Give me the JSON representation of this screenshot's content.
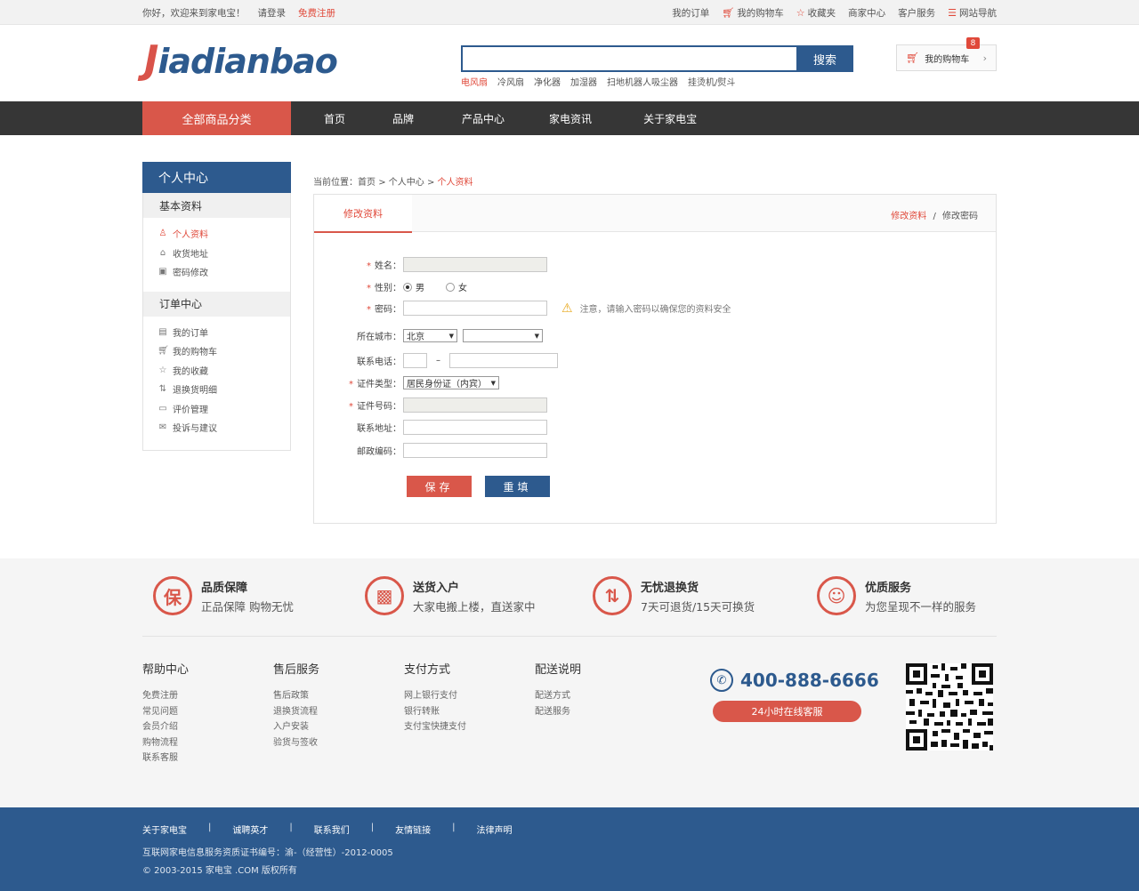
{
  "topbar": {
    "welcome": "你好，欢迎来到家电宝！",
    "login": "请登录",
    "register": "免费注册",
    "links": [
      "我的订单",
      "我的购物车",
      "收藏夹",
      "商家中心",
      "客户服务",
      "网站导航"
    ]
  },
  "header": {
    "logo_first": "J",
    "logo_rest": "iadianbao",
    "search_button": "搜索",
    "search_value": "",
    "hot_words": [
      "电风扇",
      "冷风扇",
      "净化器",
      "加湿器",
      "扫地机器人吸尘器",
      "挂烫机/熨斗"
    ],
    "cart_label": "我的购物车",
    "cart_count": "8"
  },
  "nav": {
    "all_categories": "全部商品分类",
    "items": [
      "首页",
      "品牌",
      "产品中心",
      "家电资讯",
      "关于家电宝"
    ]
  },
  "sidebar": {
    "title": "个人中心",
    "sections": [
      {
        "label": "基本资料",
        "items": [
          "个人资料",
          "收货地址",
          "密码修改"
        ]
      },
      {
        "label": "订单中心",
        "items": [
          "我的订单",
          "我的购物车",
          "我的收藏",
          "退换货明细",
          "评价管理",
          "投诉与建议"
        ]
      }
    ]
  },
  "breadcrumb": {
    "prefix": "当前位置：",
    "home": "首页",
    "sep": ">",
    "level2": "个人中心",
    "current": "个人资料"
  },
  "panel": {
    "tab": "修改资料",
    "link_active": "修改资料",
    "link_sep": "/",
    "link_other": "修改密码"
  },
  "form": {
    "name_label": "姓名：",
    "gender_label": "性别：",
    "gender_male": "男",
    "gender_female": "女",
    "password_label": "密码：",
    "password_warning": "注意，请输入密码以确保您的资料安全",
    "city_label": "所在城市：",
    "city_value": "北京",
    "district_value": "",
    "phone_label": "联系电话：",
    "phone_sep": "–",
    "id_type_label": "证件类型：",
    "id_type_value": "居民身份证（内宾）",
    "id_no_label": "证件号码：",
    "address_label": "联系地址：",
    "zip_label": "邮政编码：",
    "required_mark": "*",
    "save": "保存",
    "reset": "重填"
  },
  "services": [
    {
      "icon": "保",
      "title": "品质保障",
      "desc": "正品保障 购物无忧"
    },
    {
      "icon": "box-icon",
      "title": "送货入户",
      "desc": "大家电搬上楼，直送家中"
    },
    {
      "icon": "return-icon",
      "title": "无忧退换货",
      "desc": "7天可退货/15天可换货"
    },
    {
      "icon": "smile-icon",
      "title": "优质服务",
      "desc": "为您呈现不一样的服务"
    }
  ],
  "help": [
    {
      "title": "帮助中心",
      "links": [
        "免费注册",
        "常见问题",
        "会员介绍",
        "购物流程",
        "联系客服"
      ]
    },
    {
      "title": "售后服务",
      "links": [
        "售后政策",
        "退换货流程",
        "入户安装",
        "验货与签收"
      ]
    },
    {
      "title": "支付方式",
      "links": [
        "网上银行支付",
        "银行转账",
        "支付宝快捷支付"
      ]
    },
    {
      "title": "配送说明",
      "links": [
        "配送方式",
        "配送服务"
      ]
    }
  ],
  "contact": {
    "phone": "400-888-6666",
    "online": "24小时在线客服"
  },
  "footer": {
    "links": [
      "关于家电宝",
      "诚聘英才",
      "联系我们",
      "友情链接",
      "法律声明"
    ],
    "sep": "|",
    "license": "互联网家电信息服务资质证书编号：渝-（经营性）-2012-0005",
    "copyright": "© 2003-2015 家电宝 .COM 版权所有"
  },
  "colors": {
    "brand_blue": "#2d5a8e",
    "accent_red": "#d9574a",
    "nav_dark": "#363636"
  }
}
